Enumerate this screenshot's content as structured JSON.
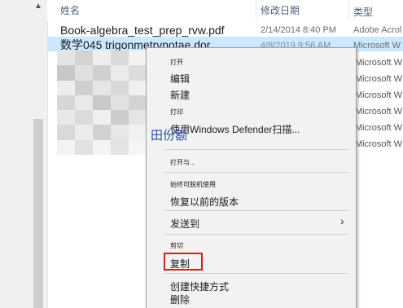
{
  "header": {
    "col_name": "姓名",
    "col_date": "修改日期",
    "col_type": "类型",
    "scroll_up_glyph": "▲"
  },
  "files": [
    {
      "name": "Book-algebra_test_prep_rvw.pdf",
      "date": "2/14/2014 8:40 PM",
      "type": "Adobe Acrol"
    },
    {
      "name": "数学045 trigonmetrvnotae dor",
      "date": "4/8/2019 9:56 AM",
      "type": "Microsoft W"
    }
  ],
  "background_types": [
    "Microsoft W",
    "Microsoft W",
    "Microsoft W",
    "Microsoft W",
    "Microsoft W",
    "Microsoft W"
  ],
  "overlay_name": "田份额",
  "context_menu": {
    "open": "打开",
    "edit": "编辑",
    "new": "新建",
    "print": "打印",
    "defender": "使用Windows Defender扫描...",
    "open_with": "打开与...",
    "always_offline": "始终可脱机使用",
    "restore": "恢复以前的版本",
    "send_to": "发送到",
    "send_to_arrow": "›",
    "cut": "剪切",
    "copy": "复制",
    "create_shortcut": "创建快捷方式",
    "delete": "删除"
  },
  "colors": {
    "selection": "#cce8ff",
    "highlight_border": "#d21f1f",
    "menu_bg": "#f2f2f2",
    "overlay_text": "#2a4f9a"
  }
}
